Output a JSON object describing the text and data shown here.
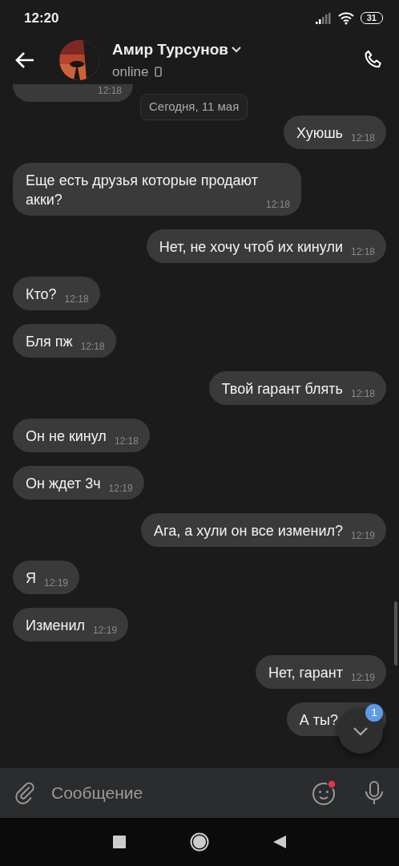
{
  "status_bar": {
    "time": "12:20",
    "battery": "31"
  },
  "header": {
    "name": "Амир Турсунов",
    "status": "online"
  },
  "date_pill": "Сегодня, 11 мая",
  "messages": [
    {
      "kind": "in",
      "time": "12:18"
    },
    {
      "kind": "out",
      "text": "Хуюшь",
      "time": "12:18"
    },
    {
      "kind": "in",
      "text": "Еще есть друзья которые продают акки?",
      "time": "12:18"
    },
    {
      "kind": "out",
      "text": "Нет, не хочу чтоб их кинули",
      "time": "12:18"
    },
    {
      "kind": "in",
      "text": "Кто?",
      "time": "12:18"
    },
    {
      "kind": "in",
      "text": "Бля пж",
      "time": "12:18"
    },
    {
      "kind": "out",
      "text": "Твой гарант блять",
      "time": "12:18"
    },
    {
      "kind": "in",
      "text": "Он не кинул",
      "time": "12:18"
    },
    {
      "kind": "in",
      "text": "Он ждет 3ч",
      "time": "12:19"
    },
    {
      "kind": "out",
      "text": "Ага, а хули он все изменил?",
      "time": "12:19"
    },
    {
      "kind": "in",
      "text": "Я",
      "time": "12:19"
    },
    {
      "kind": "in",
      "text": "Изменил",
      "time": "12:19"
    },
    {
      "kind": "out",
      "text": "Нет, гарант",
      "time": "12:19"
    },
    {
      "kind": "out",
      "text": "А ты?"
    }
  ],
  "scroll_down": {
    "badge": "1"
  },
  "composer": {
    "placeholder": "Сообщение",
    "emoji_notification": true
  }
}
